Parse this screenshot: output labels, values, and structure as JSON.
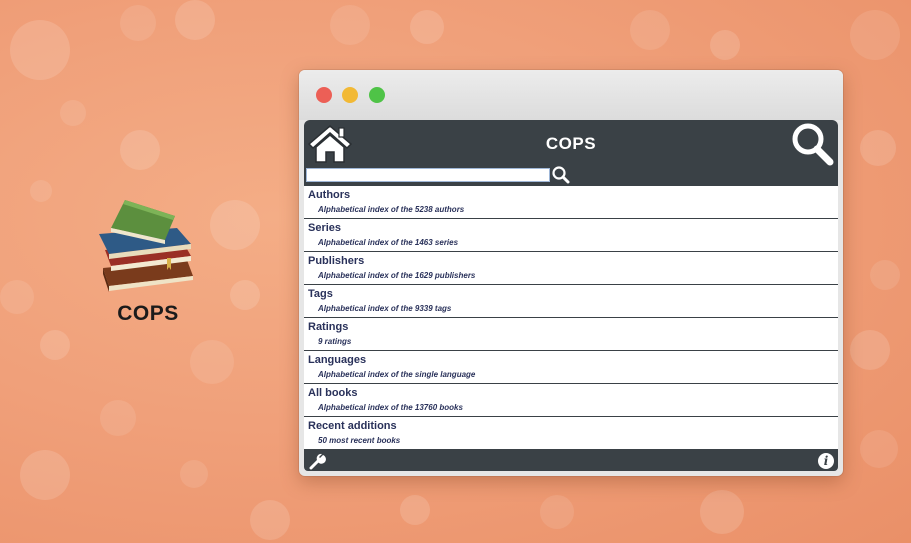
{
  "logo": {
    "text": "COPS"
  },
  "window": {
    "controls": [
      "close",
      "minimize",
      "maximize"
    ]
  },
  "header": {
    "title": "COPS",
    "home_icon": "home-icon",
    "search_icon": "search-icon"
  },
  "search": {
    "value": "",
    "placeholder": ""
  },
  "menu": [
    {
      "title": "Authors",
      "desc": "Alphabetical index of the 5238 authors"
    },
    {
      "title": "Series",
      "desc": "Alphabetical index of the 1463 series"
    },
    {
      "title": "Publishers",
      "desc": "Alphabetical index of the 1629 publishers"
    },
    {
      "title": "Tags",
      "desc": "Alphabetical index of the 9339 tags"
    },
    {
      "title": "Ratings",
      "desc": "9 ratings"
    },
    {
      "title": "Languages",
      "desc": "Alphabetical index of the single language"
    },
    {
      "title": "All books",
      "desc": "Alphabetical index of the 13760 books"
    },
    {
      "title": "Recent additions",
      "desc": "50 most recent books"
    }
  ],
  "footer": {
    "settings_icon": "wrench-icon",
    "info_icon": "info-icon",
    "info_glyph": "i"
  },
  "colors": {
    "background": "#f0a07a",
    "app_bar": "#3a4146",
    "link_text": "#29315a",
    "close": "#ec5f56",
    "minimize": "#f2b935",
    "maximize": "#4fc347"
  }
}
